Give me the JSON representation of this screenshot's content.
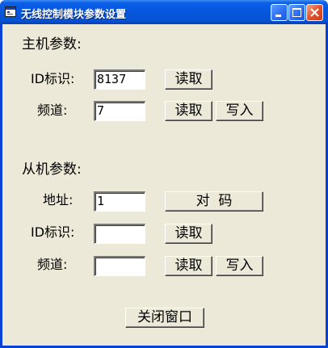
{
  "window": {
    "title": "无线控制模块参数设置"
  },
  "host": {
    "section_label": "主机参数:",
    "id_label": "ID标识:",
    "id_value": "8137",
    "channel_label": "频道:",
    "channel_value": "7",
    "read_id_button": "读取",
    "read_channel_button": "读取",
    "write_channel_button": "写入"
  },
  "slave": {
    "section_label": "从机参数:",
    "address_label": "地址:",
    "address_value": "1",
    "pair_button": "对  码",
    "id_label": "ID标识:",
    "id_value": "",
    "read_id_button": "读取",
    "channel_label": "频道:",
    "channel_value": "",
    "read_channel_button": "读取",
    "write_channel_button": "写入"
  },
  "footer": {
    "close_button": "关闭窗口"
  }
}
